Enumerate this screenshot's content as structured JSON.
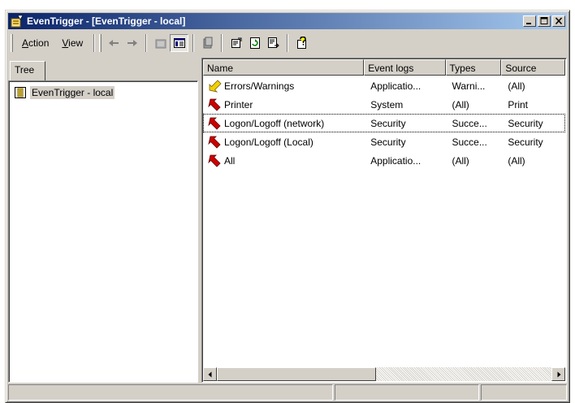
{
  "window": {
    "title": "EvenTrigger - [EvenTrigger - local]",
    "controls": {
      "minimize": "_",
      "maximize": "□",
      "close": "×"
    }
  },
  "menubar": {
    "items": [
      {
        "label": "Action",
        "accel": "A"
      },
      {
        "label": "View",
        "accel": "V"
      }
    ]
  },
  "toolbar": {
    "icons": [
      "back-arrow-icon",
      "forward-arrow-icon",
      "up-folder-icon",
      "show-hide-tree-icon",
      "delete-icon",
      "properties-icon",
      "refresh-icon",
      "export-list-icon",
      "help-icon"
    ]
  },
  "tree": {
    "tab_label": "Tree",
    "root_label": "EvenTrigger - local"
  },
  "list": {
    "columns": [
      "Name",
      "Event logs",
      "Types",
      "Source"
    ],
    "rows": [
      {
        "name": "Errors/Warnings",
        "logs": "Applicatio...",
        "types": "Warni...",
        "source": "(All)",
        "icon": "yellow-arrow-icon"
      },
      {
        "name": "Printer",
        "logs": "System",
        "types": "(All)",
        "source": "Print",
        "icon": "red-arrow-icon"
      },
      {
        "name": "Logon/Logoff (network)",
        "logs": "Security",
        "types": "Succe...",
        "source": "Security",
        "icon": "red-arrow-icon"
      },
      {
        "name": "Logon/Logoff (Local)",
        "logs": "Security",
        "types": "Succe...",
        "source": "Security",
        "icon": "red-arrow-icon"
      },
      {
        "name": "All",
        "logs": "Applicatio...",
        "types": "(All)",
        "source": "(All)",
        "icon": "red-arrow-icon"
      }
    ]
  },
  "colors": {
    "title_start": "#0a246a",
    "title_end": "#a6caf0",
    "face": "#d4d0c8",
    "arrow_red": "#cc0000",
    "arrow_yellow": "#f0d000"
  }
}
